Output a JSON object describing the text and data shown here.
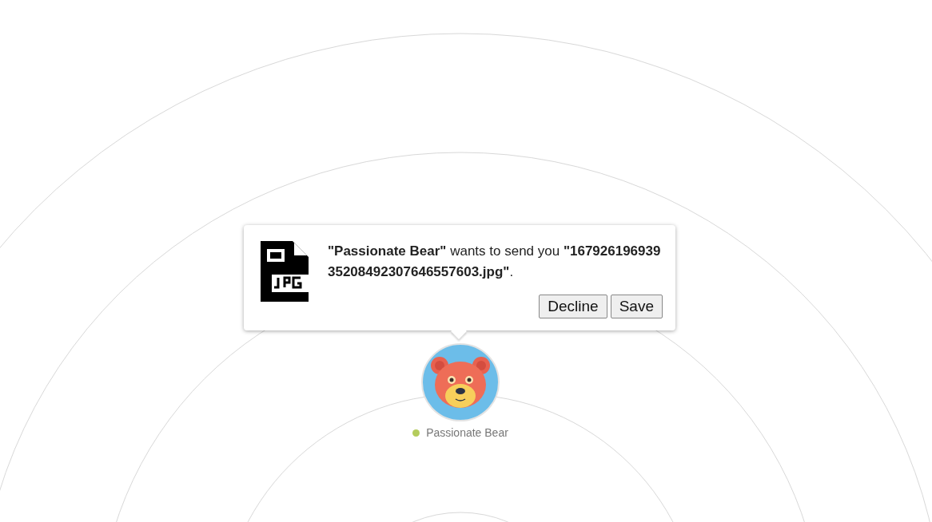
{
  "request": {
    "message": "**\"Passionate Bear\"** wants to send you **\"16792619693935208492307646557603.jpg\"**.",
    "buttons": [
      "Decline",
      "Save"
    ]
  },
  "peers": [
    {
      "name": "Passionate Bear",
      "color": "#b4cc5c"
    }
  ]
}
